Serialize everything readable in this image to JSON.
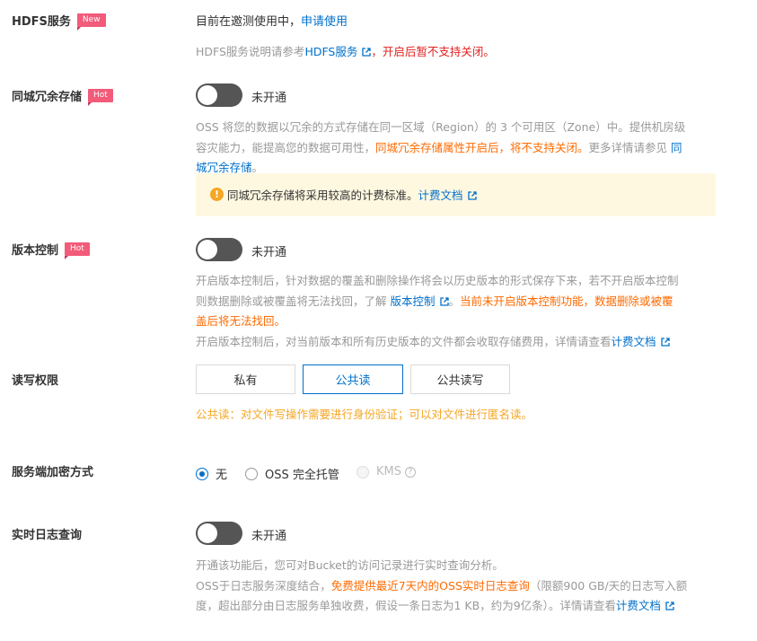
{
  "hdfs": {
    "label": "HDFS服务",
    "tag": "New",
    "status_text": "目前在邀测使用中，",
    "apply_link": "申请使用",
    "desc_prefix": "HDFS服务说明请参考",
    "desc_link": "HDFS服务",
    "desc_warning": "，开启后暂不支持关闭。"
  },
  "redundancy": {
    "label": "同城冗余存储",
    "tag": "Hot",
    "switch_text": "未开通",
    "desc_part1": "OSS 将您的数据以冗余的方式存储在同一区域（Region）的 3 个可用区（Zone）中。提供机房级",
    "desc_part2": "容灾能力，能提高您的数据可用性，",
    "desc_highlight": "同城冗余存储属性开启后，将不支持关闭。",
    "desc_part3": "更多详情请参见",
    "desc_link_a": "同",
    "desc_link_b": "城冗余存储",
    "desc_end": "。",
    "notice_text": "同城冗余存储将采用较高的计费标准。",
    "notice_link": "计费文档"
  },
  "versioning": {
    "label": "版本控制",
    "tag": "Hot",
    "switch_text": "未开通",
    "desc_line1": "开启版本控制后，针对数据的覆盖和删除操作将会以历史版本的形式保存下来，若不开启版本控制",
    "desc_line2_a": "则数据删除或被覆盖将无法找回，了解",
    "desc_link": "版本控制",
    "desc_line2_b": "。",
    "desc_warn_a": "当前未开启版本控制功能，数据删除或被覆",
    "desc_warn_b": "盖后将无法找回。",
    "desc_line4": "开启版本控制后，对当前版本和所有历史版本的文件都会收取存储费用，详情请查看",
    "desc_line4_link": "计费文档"
  },
  "acl": {
    "label": "读写权限",
    "options": [
      "私有",
      "公共读",
      "公共读写"
    ],
    "selected": "公共读",
    "hint": "公共读：对文件写操作需要进行身份验证；可以对文件进行匿名读。"
  },
  "encryption": {
    "label": "服务端加密方式",
    "options": [
      "无",
      "OSS 完全托管",
      "KMS"
    ],
    "selected": "无"
  },
  "realtime_log": {
    "label": "实时日志查询",
    "switch_text": "未开通",
    "desc_line1": "开通该功能后，您可对Bucket的访问记录进行实时查询分析。",
    "desc_line2_a": "OSS于日志服务深度结合，",
    "desc_line2_highlight": "免费提供最近7天内的OSS实时日志查询",
    "desc_line2_b": "（限额900 GB/天的日志写入额",
    "desc_line3": "度，超出部分由日志服务单独收费，假设一条日志为1 KB，约为9亿条）。详情请查看",
    "desc_line3_link": "计费文档"
  },
  "colors": {
    "accent": "#0070cc",
    "warning_red": "#e02020",
    "warning_orange": "#ff6a00",
    "hint_yellow": "#f5a623",
    "tag": "#f25b7a",
    "switch_off": "#555555"
  }
}
